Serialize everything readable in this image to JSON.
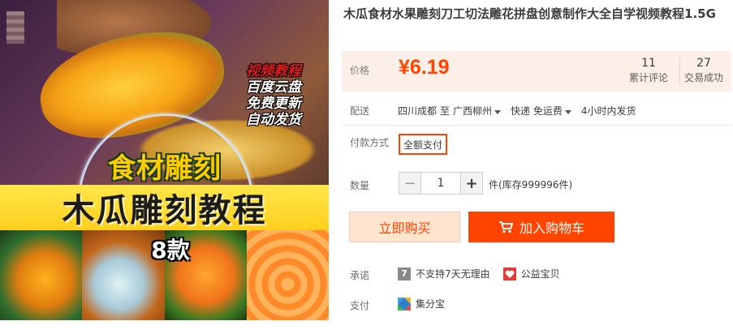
{
  "product_image": {
    "badge_lines": [
      "视频教程",
      "百度云盘",
      "免费更新",
      "自动发货"
    ],
    "small_banner": "食材雕刻",
    "big_banner": "木瓜雕刻教程",
    "count_badge": "8款"
  },
  "title": "木瓜食材水果雕刻刀工切法雕花拼盘创意制作大全自学视频教程1.5G",
  "price": {
    "label": "价格",
    "currency": "¥",
    "value": "6.19",
    "color": "#ff4400",
    "panel_bg": "#fcefe7"
  },
  "stats": {
    "reviews_count": "11",
    "reviews_label": "累计评论",
    "sales_count": "27",
    "sales_label": "交易成功"
  },
  "shipping": {
    "label": "配送",
    "from": "四川成都",
    "to_word": "至",
    "to": "广西柳州",
    "method": "快递 免运费",
    "dispatch": "4小时内发货"
  },
  "payment_method": {
    "label": "付款方式",
    "option": "全额支付"
  },
  "quantity": {
    "label": "数量",
    "minus": "−",
    "value": "1",
    "plus": "+",
    "stock": "件(库存999996件)"
  },
  "actions": {
    "buy_now": "立即购买",
    "add_to_cart": "加入购物车",
    "accent": "#ff4400"
  },
  "promise": {
    "label": "承诺",
    "icon_7_text": "7",
    "no_return": "不支持7天无理由",
    "charity": "公益宝贝"
  },
  "pay": {
    "label": "支付",
    "jifenbao": "集分宝"
  }
}
